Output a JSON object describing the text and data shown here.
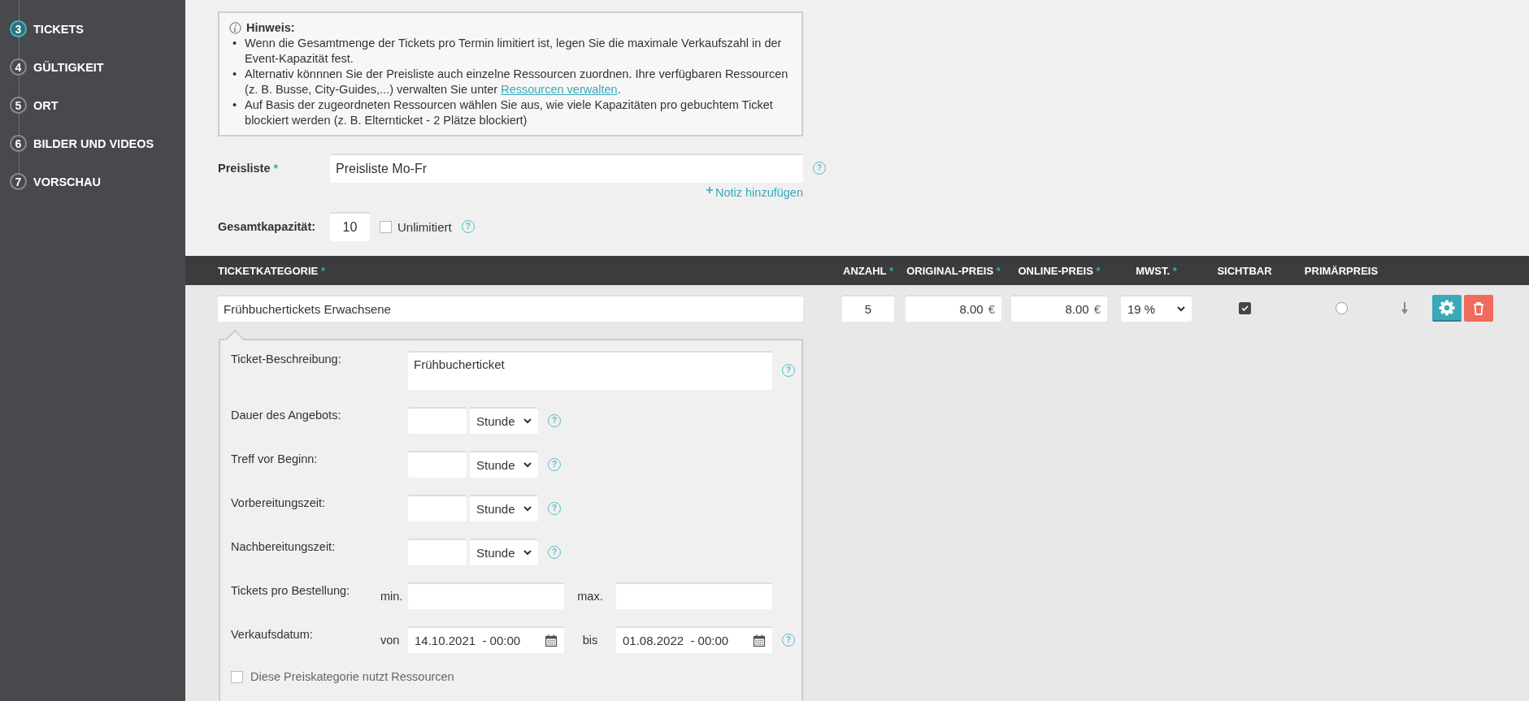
{
  "sidebar": {
    "steps": [
      {
        "number": "3",
        "label": "TICKETS",
        "selected": true
      },
      {
        "number": "4",
        "label": "GÜLTIGKEIT",
        "selected": false
      },
      {
        "number": "5",
        "label": "ORT",
        "selected": false
      },
      {
        "number": "6",
        "label": "BILDER UND VIDEOS",
        "selected": false
      },
      {
        "number": "7",
        "label": "VORSCHAU",
        "selected": false
      }
    ]
  },
  "hint": {
    "title": "Hinweis:",
    "items": [
      {
        "bullet": "•",
        "text": "Wenn die Gesamtmenge der Tickets pro Termin limitiert ist, legen Sie die maximale Verkaufszahl in der Event-Kapazität fest."
      },
      {
        "bullet": "•",
        "text": "Alternativ könnnen Sie der Preisliste auch einzelne Ressourcen zuordnen. Ihre verfügbaren Ressourcen (z. B. Busse, City-Guides,...) verwalten Sie unter ",
        "link": "Ressourcen verwalten",
        "after": "."
      },
      {
        "bullet": "•",
        "text": "Auf Basis der zugeordneten Ressourcen wählen Sie aus, wie viele Kapazitäten pro gebuchtem Ticket blockiert werden (z. B. Elternticket - 2 Plätze blockiert)"
      }
    ]
  },
  "price_list": {
    "label": "Preisliste",
    "required_mark": "*",
    "value": "Preisliste Mo-Fr",
    "help": "?",
    "note_link": "Notiz hinzufügen"
  },
  "capacity": {
    "label": "Gesamtkapazität:",
    "value": "10",
    "unlimited": {
      "label": "Unlimitiert",
      "checked": false
    },
    "help": "?"
  },
  "table": {
    "columns": [
      {
        "label": "TICKETKATEGORIE",
        "required_mark": "*"
      },
      {
        "label": "ANZAHL",
        "required_mark": "*"
      },
      {
        "label": "ORIGINAL-PREIS",
        "required_mark": "*"
      },
      {
        "label": "ONLINE-PREIS",
        "required_mark": "*"
      },
      {
        "label": "MWST.",
        "required_mark": "*"
      },
      {
        "label": "SICHTBAR"
      },
      {
        "label": "PRIMÄRPREIS"
      }
    ],
    "rows": [
      {
        "category": "Frühbuchertickets Erwachsene",
        "count": "5",
        "original_price": {
          "value": "8.00",
          "unit": "€"
        },
        "online_price": {
          "value": "8.00",
          "unit": "€"
        },
        "vat": "19 %",
        "visible": true,
        "primary": false,
        "details": {
          "description": {
            "label": "Ticket-Beschreibung:",
            "value": "Frühbucherticket",
            "help": "?"
          },
          "durations": [
            {
              "label": "Dauer des Angebots:",
              "unit": "Stunde",
              "help": "?"
            },
            {
              "label": "Treff vor Beginn:",
              "unit": "Stunde",
              "help": "?"
            },
            {
              "label": "Vorbereitungszeit:",
              "unit": "Stunde",
              "help": "?"
            },
            {
              "label": "Nachbereitungszeit:",
              "unit": "Stunde",
              "help": "?"
            }
          ],
          "tickets_per_order": {
            "label": "Tickets pro Bestellung:",
            "min_label": "min.",
            "max_label": "max."
          },
          "sale_date": {
            "label": "Verkaufsdatum:",
            "from_label": "von",
            "from": "14.10.2021  - 00:00",
            "to_label": "bis",
            "to": "01.08.2022  - 00:00",
            "help": "?"
          },
          "resources": {
            "label": "Diese Preiskategorie nutzt Ressourcen",
            "checked": false
          }
        }
      }
    ]
  }
}
